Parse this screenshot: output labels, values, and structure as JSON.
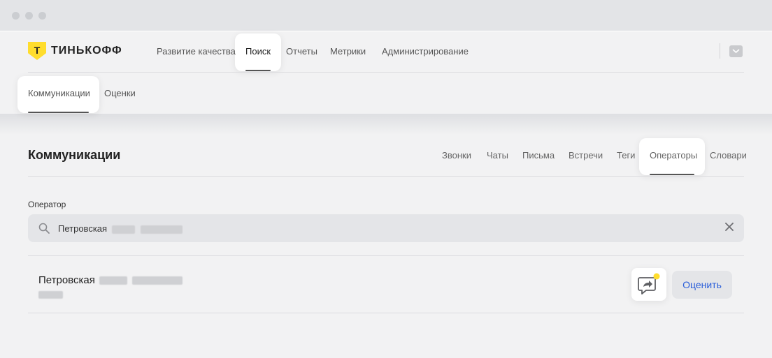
{
  "brand": {
    "logo_letter": "Т",
    "name": "ТИНЬКОФФ"
  },
  "topnav": {
    "items": [
      {
        "label": "Развитие качества"
      },
      {
        "label": "Поиск"
      },
      {
        "label": "Отчеты"
      },
      {
        "label": "Метрики"
      },
      {
        "label": "Администрирование"
      }
    ],
    "active": "Поиск"
  },
  "subnav": {
    "items": [
      {
        "label": "Коммуникации"
      },
      {
        "label": "Оценки"
      }
    ],
    "active": "Коммуникации"
  },
  "page": {
    "title": "Коммуникации",
    "tabs": [
      {
        "label": "Звонки"
      },
      {
        "label": "Чаты"
      },
      {
        "label": "Письма"
      },
      {
        "label": "Встречи"
      },
      {
        "label": "Теги"
      },
      {
        "label": "Операторы"
      },
      {
        "label": "Словари"
      }
    ],
    "active_tab": "Операторы"
  },
  "operator_search": {
    "label": "Оператор",
    "value_visible": "Петровская",
    "value_redacted": true
  },
  "result": {
    "name_visible": "Петровская",
    "name_redacted": true,
    "subtitle_redacted": true,
    "rate_label": "Оценить"
  },
  "colors": {
    "brand_yellow": "#ffdd2d",
    "link_blue": "#2b5fd9",
    "notification_dot": "#ffdd2d"
  },
  "icons": [
    "search-icon",
    "clear-icon",
    "feedback-share-icon",
    "account-menu-icon"
  ]
}
